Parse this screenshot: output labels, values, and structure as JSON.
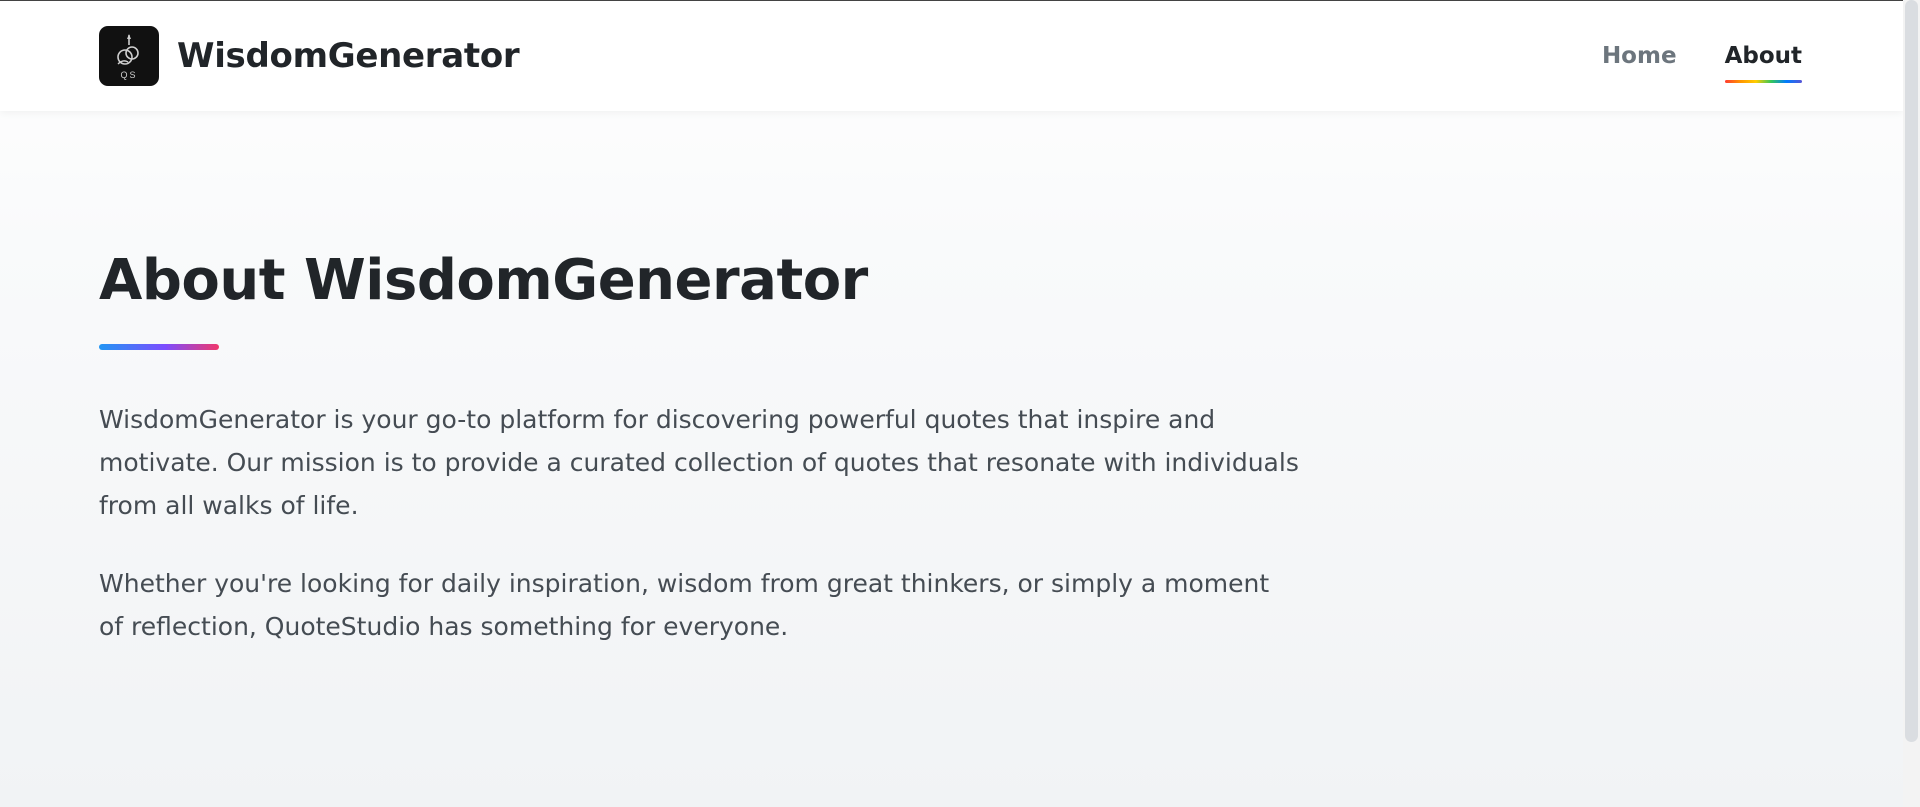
{
  "header": {
    "brand_name": "WisdomGenerator",
    "logo_text": "QS",
    "nav": [
      {
        "label": "Home",
        "active": false
      },
      {
        "label": "About",
        "active": true
      }
    ]
  },
  "main": {
    "title": "About WisdomGenerator",
    "paragraphs": [
      "WisdomGenerator is your go-to platform for discovering powerful quotes that inspire and motivate. Our mission is to provide a curated collection of quotes that resonate with individuals from all walks of life.",
      "Whether you're looking for daily inspiration, wisdom from great thinkers, or simply a moment of reflection, QuoteStudio has something for everyone."
    ]
  },
  "colors": {
    "title_accent_start": "#2196f3",
    "title_accent_mid": "#7c4dff",
    "title_accent_end": "#f0386b",
    "logo_bg": "#111111",
    "text_dark": "#212529",
    "text_muted": "#6c757d"
  },
  "icons": {
    "logo": "quill-rings-logo-icon"
  }
}
